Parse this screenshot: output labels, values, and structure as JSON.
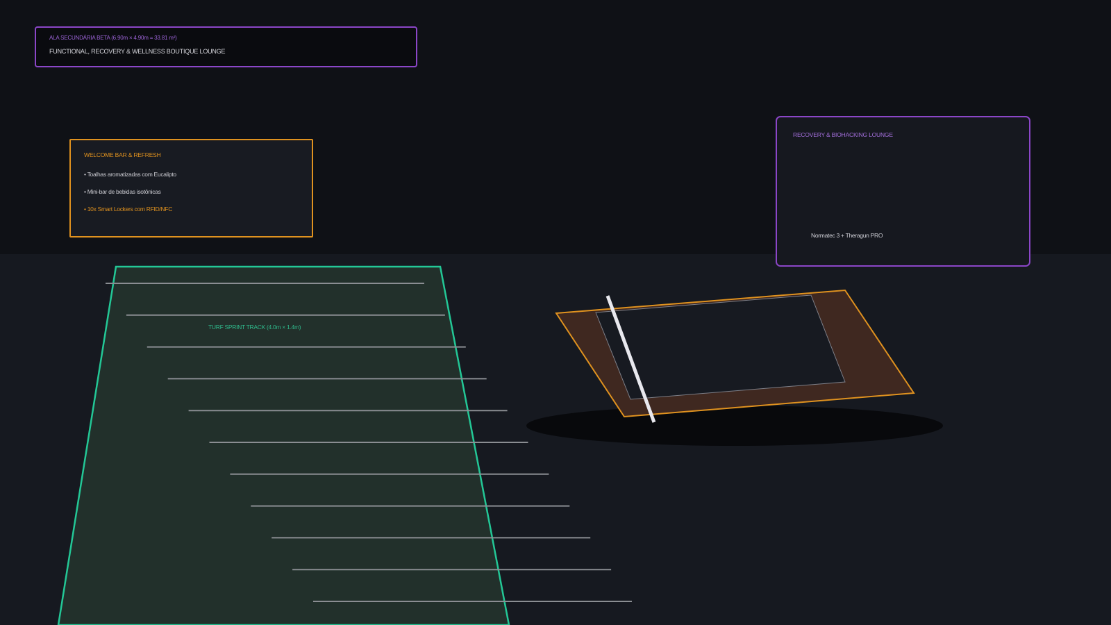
{
  "header": {
    "kicker": "ALA SECUNDÁRIA BETA (6.90m × 4.90m = 33.81 m²)",
    "title": "FUNCTIONAL, RECOVERY & WELLNESS BOUTIQUE LOUNGE"
  },
  "welcome_bar": {
    "title": "WELCOME BAR & REFRESH",
    "items": [
      "• Toalhas aromatizadas com Eucalipto",
      "• Mini-bar de bebidas isotônicas",
      "• 10x Smart Lockers com RFID/NFC"
    ]
  },
  "recovery_lounge": {
    "title": "RECOVERY & BIOHACKING LOUNGE",
    "device": "Normatec 3 + Theragun PRO"
  },
  "track": {
    "label": "TURF SPRINT TRACK (4.0m × 1.4m)"
  },
  "colors": {
    "purple": "#8b46c8",
    "orange": "#e0921f",
    "green": "#2fb98b",
    "wall": "#0f1116",
    "floor": "#161920"
  }
}
